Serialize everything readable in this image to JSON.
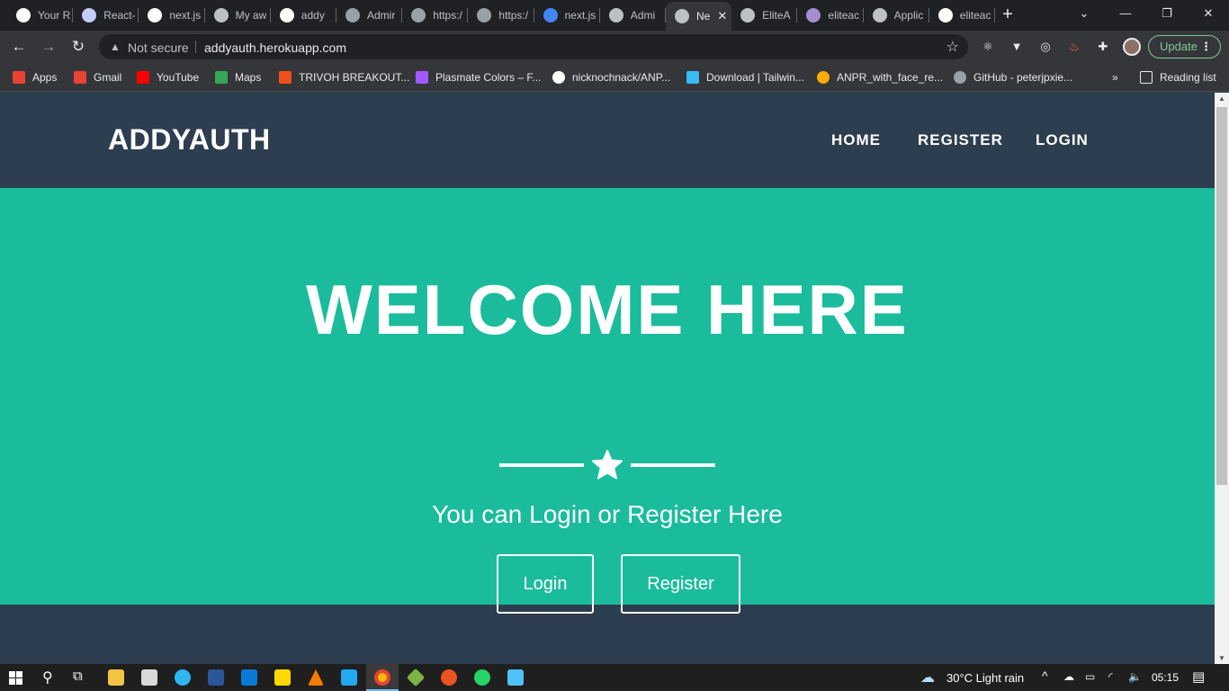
{
  "browser": {
    "tabs": [
      {
        "title": "Your R",
        "icon": "github-icon",
        "color": "#ffffff"
      },
      {
        "title": "React-",
        "icon": "gmail-icon",
        "color": "#c5cbff"
      },
      {
        "title": "next.js",
        "icon": "github-icon",
        "color": "#ffffff"
      },
      {
        "title": "My aw",
        "icon": "globe-icon",
        "color": "#bdc1c6"
      },
      {
        "title": "addy",
        "icon": "vercel-icon",
        "color": "#ffffff"
      },
      {
        "title": "Admir",
        "icon": "triangle-icon",
        "color": "#9aa0a6"
      },
      {
        "title": "https:/",
        "icon": "triangle-icon",
        "color": "#9aa0a6"
      },
      {
        "title": "https:/",
        "icon": "triangle-icon",
        "color": "#9aa0a6"
      },
      {
        "title": "next.js",
        "icon": "google-icon",
        "color": "#4285f4"
      },
      {
        "title": "Admi",
        "icon": "globe-icon",
        "color": "#bdc1c6"
      },
      {
        "title": "Ne",
        "icon": "globe-icon",
        "color": "#bdc1c6"
      },
      {
        "title": "EliteA",
        "icon": "globe-icon",
        "color": "#bdc1c6"
      },
      {
        "title": "eliteac",
        "icon": "heroku-icon",
        "color": "#a38ed1"
      },
      {
        "title": "Applic",
        "icon": "globe-icon",
        "color": "#bdc1c6"
      },
      {
        "title": "eliteac",
        "icon": "github-icon",
        "color": "#ffffff"
      }
    ],
    "active_tab_index": 10,
    "new_tab_label": "+",
    "address": {
      "security_label": "Not secure",
      "url": "addyauth.herokuapp.com"
    },
    "update_label": "Update",
    "bookmarks": [
      {
        "label": "Apps",
        "icon": "apps-grid-icon",
        "color": "#ea4335"
      },
      {
        "label": "Gmail",
        "icon": "gmail-icon",
        "color": "#ea4335"
      },
      {
        "label": "YouTube",
        "icon": "youtube-icon",
        "color": "#ff0000"
      },
      {
        "label": "Maps",
        "icon": "maps-icon",
        "color": "#34a853"
      },
      {
        "label": "TRIVOH BREAKOUT...",
        "icon": "figma-icon",
        "color": "#f24e1e"
      },
      {
        "label": "Plasmate Colors – F...",
        "icon": "figma-icon",
        "color": "#a259ff"
      },
      {
        "label": "nicknochnack/ANP...",
        "icon": "github-icon",
        "color": "#ffffff"
      },
      {
        "label": "Download | Tailwin...",
        "icon": "tailwind-icon",
        "color": "#38bdf8"
      },
      {
        "label": "ANPR_with_face_re...",
        "icon": "colab-icon",
        "color": "#f9ab00"
      },
      {
        "label": "GitHub - peterjpxie...",
        "icon": "github-icon",
        "color": "#9aa0a6"
      }
    ],
    "bookmarks_overflow": "»",
    "reading_list_label": "Reading list"
  },
  "site": {
    "brand": "ADDYAUTH",
    "nav": [
      {
        "label": "HOME"
      },
      {
        "label": "REGISTER"
      },
      {
        "label": "LOGIN"
      }
    ],
    "hero": {
      "title": "WELCOME HERE",
      "subtitle": "You can Login or Register Here",
      "login_button": "Login",
      "register_button": "Register"
    },
    "colors": {
      "nav_bg": "#2c3e50",
      "hero_bg": "#1abc9c",
      "text": "#ffffff"
    }
  },
  "taskbar": {
    "weather": "30°C  Light rain",
    "time": "05:15"
  }
}
